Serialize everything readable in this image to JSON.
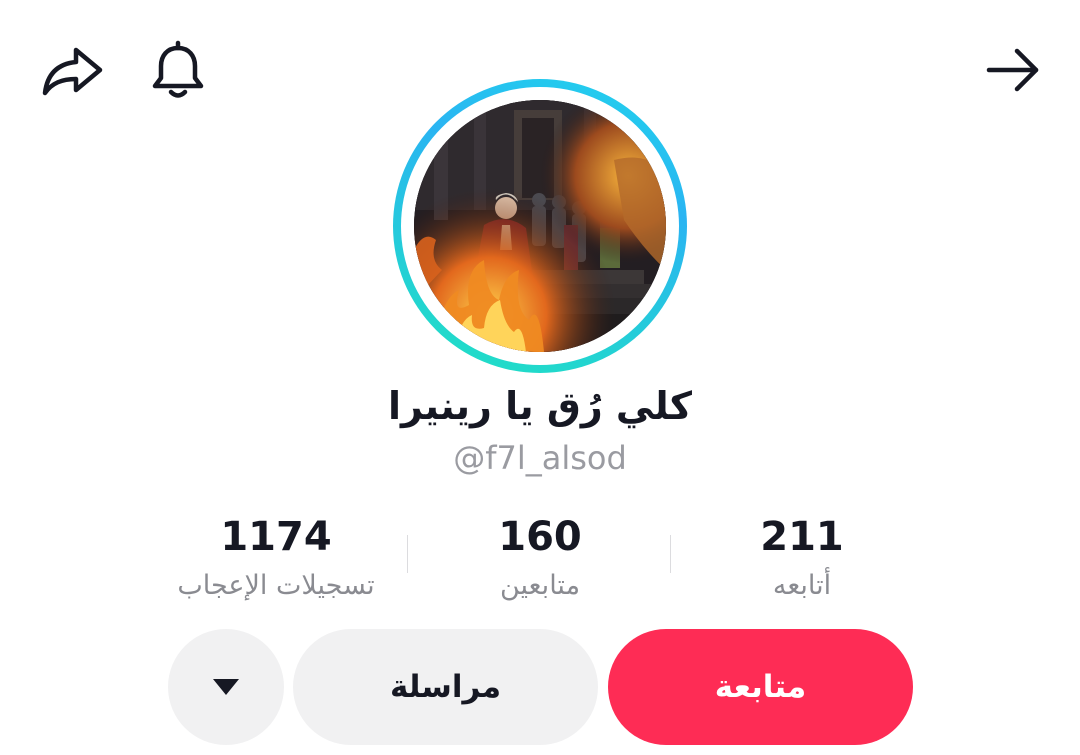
{
  "profile": {
    "display_name": "كلي رُق يا رينيرا",
    "username": "@f7l_alsod"
  },
  "stats": {
    "likes": {
      "value": "1174",
      "label": "تسجيلات الإعجاب"
    },
    "followers": {
      "value": "160",
      "label": "متابعين"
    },
    "following": {
      "value": "211",
      "label": "أتابعه"
    }
  },
  "actions": {
    "follow_label": "متابعة",
    "message_label": "مراسلة"
  },
  "icons": {
    "share": "share-icon",
    "notifications": "bell-icon",
    "back": "arrow-right-icon",
    "more": "triangle-down-icon"
  },
  "colors": {
    "follow_button": "#fe2c55",
    "secondary_button": "#f1f1f2",
    "avatar_ring": "#20d5ec",
    "muted_text": "#8a8b91"
  }
}
